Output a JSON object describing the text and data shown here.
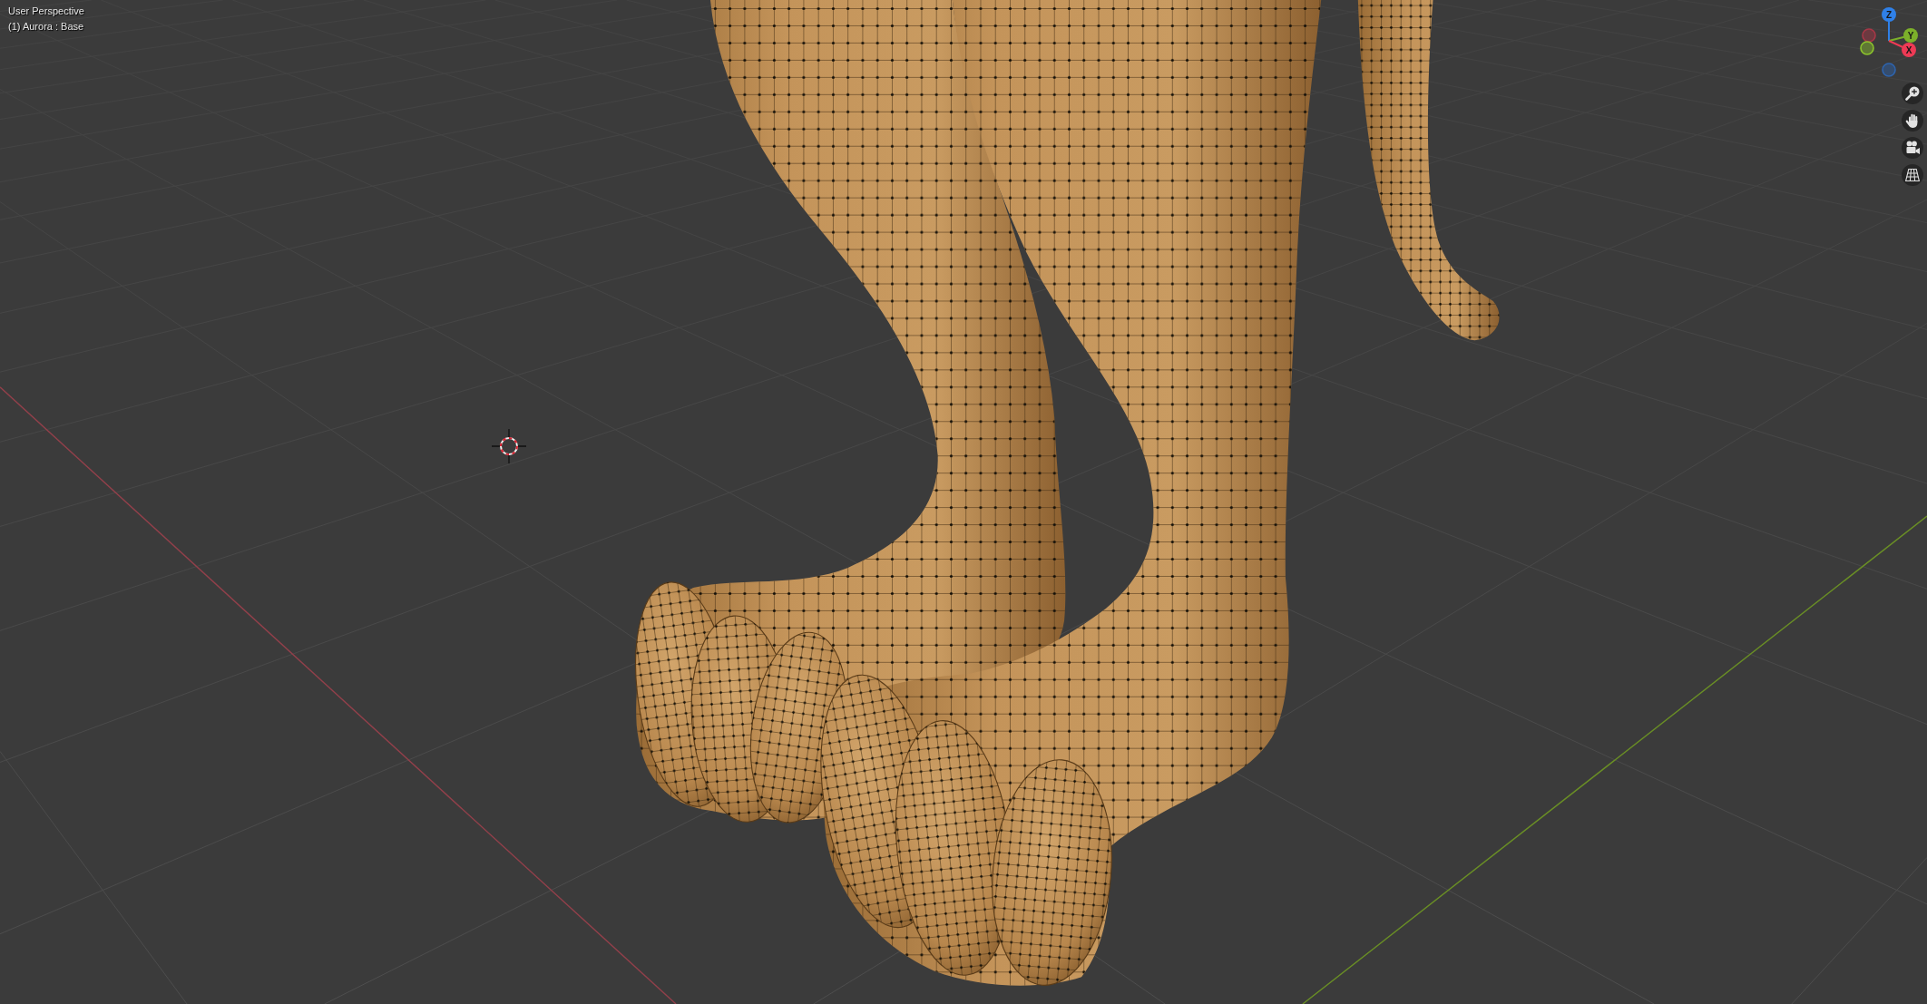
{
  "viewport": {
    "view_name": "User Perspective",
    "object_info": "(1) Aurora : Base"
  },
  "gizmo": {
    "axes": [
      {
        "label": "Z",
        "color": "#2f80e8"
      },
      {
        "label": "Y",
        "color": "#7cb02a"
      },
      {
        "label": "X",
        "color": "#ee3a55"
      }
    ],
    "negative_axes": [
      {
        "color": "#a83747"
      },
      {
        "color": "#8cc42c"
      },
      {
        "color": "#2e64ae"
      }
    ]
  }
}
